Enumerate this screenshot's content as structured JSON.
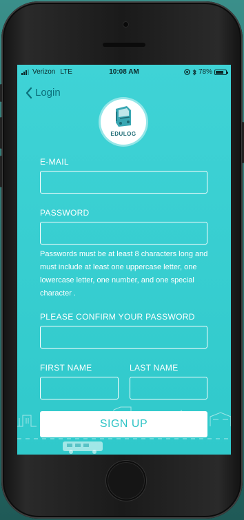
{
  "status_bar": {
    "carrier": "Verizon",
    "network": "LTE",
    "time": "10:08 AM",
    "battery": "78%",
    "battery_level": 0.78
  },
  "nav": {
    "back_label": "Login"
  },
  "logo": {
    "brand": "EDULOG"
  },
  "form": {
    "email_label": "E-MAIL",
    "password_label": "PASSWORD",
    "password_hint": "Passwords must be at least 8 characters long and must include at least one uppercase letter, one lowercase letter, one number, and one special character .",
    "confirm_label": "PLEASE CONFIRM YOUR PASSWORD",
    "first_name_label": "FIRST NAME",
    "last_name_label": "LAST NAME",
    "submit_label": "SIGN UP",
    "email_value": "",
    "password_value": "",
    "confirm_value": "",
    "first_name_value": "",
    "last_name_value": ""
  },
  "colors": {
    "screen_bg": "#3fd3d6",
    "back_accent": "#0b6f7a",
    "button_text": "#2cc3c5"
  },
  "icons": {
    "back": "chevron-left-icon",
    "signal": "signal-bars-icon",
    "location": "location-icon",
    "bluetooth": "bluetooth-icon",
    "battery": "battery-icon"
  }
}
